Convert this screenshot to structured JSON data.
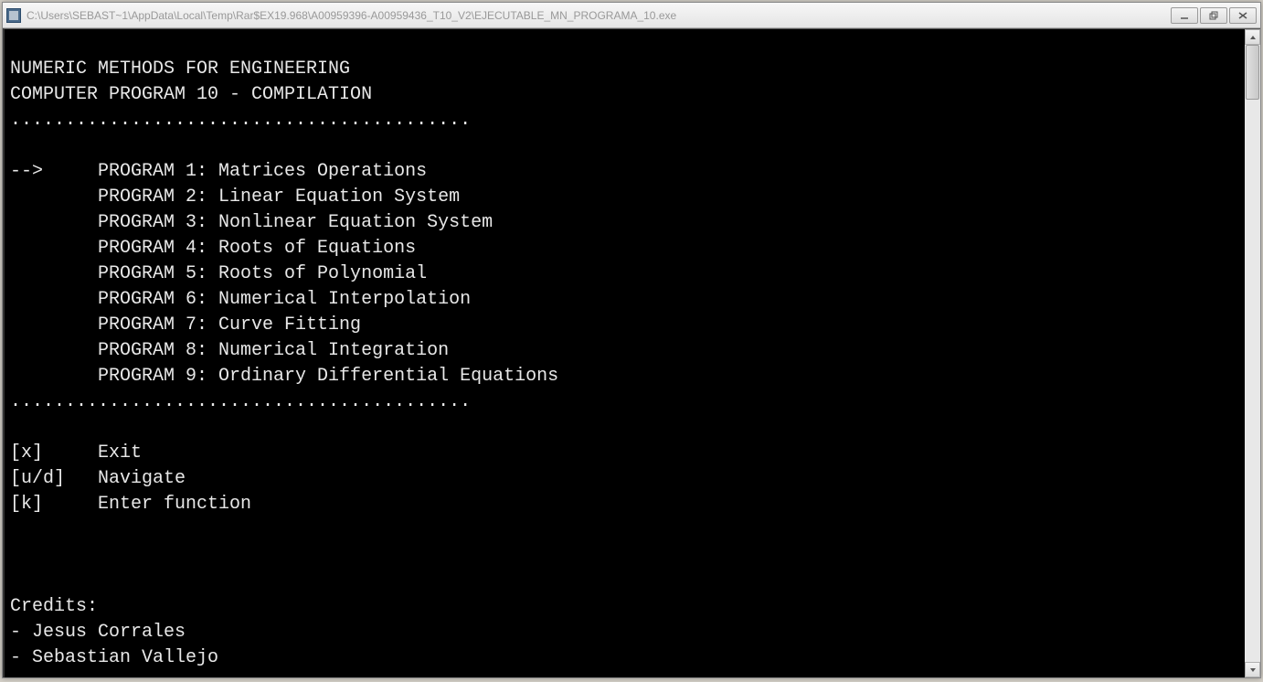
{
  "window": {
    "title": "C:\\Users\\SEBAST~1\\AppData\\Local\\Temp\\Rar$EX19.968\\A00959396-A00959436_T10_V2\\EJECUTABLE_MN_PROGRAMA_10.exe"
  },
  "console": {
    "header1": "NUMERIC METHODS FOR ENGINEERING",
    "header2": "COMPUTER PROGRAM 10 - COMPILATION",
    "divider": "..........................................",
    "selector": "-->",
    "programs": [
      {
        "label": "PROGRAM 1:",
        "name": "Matrices Operations",
        "selected": true
      },
      {
        "label": "PROGRAM 2:",
        "name": "Linear Equation System",
        "selected": false
      },
      {
        "label": "PROGRAM 3:",
        "name": "Nonlinear Equation System",
        "selected": false
      },
      {
        "label": "PROGRAM 4:",
        "name": "Roots of Equations",
        "selected": false
      },
      {
        "label": "PROGRAM 5:",
        "name": "Roots of Polynomial",
        "selected": false
      },
      {
        "label": "PROGRAM 6:",
        "name": "Numerical Interpolation",
        "selected": false
      },
      {
        "label": "PROGRAM 7:",
        "name": "Curve Fitting",
        "selected": false
      },
      {
        "label": "PROGRAM 8:",
        "name": "Numerical Integration",
        "selected": false
      },
      {
        "label": "PROGRAM 9:",
        "name": "Ordinary Differential Equations",
        "selected": false
      }
    ],
    "controls": [
      {
        "key": "[x]",
        "action": "Exit"
      },
      {
        "key": "[u/d]",
        "action": "Navigate"
      },
      {
        "key": "[k]",
        "action": "Enter function"
      }
    ],
    "credits_heading": "Credits:",
    "credits": [
      "- Jesus Corrales",
      "- Sebastian Vallejo"
    ]
  }
}
